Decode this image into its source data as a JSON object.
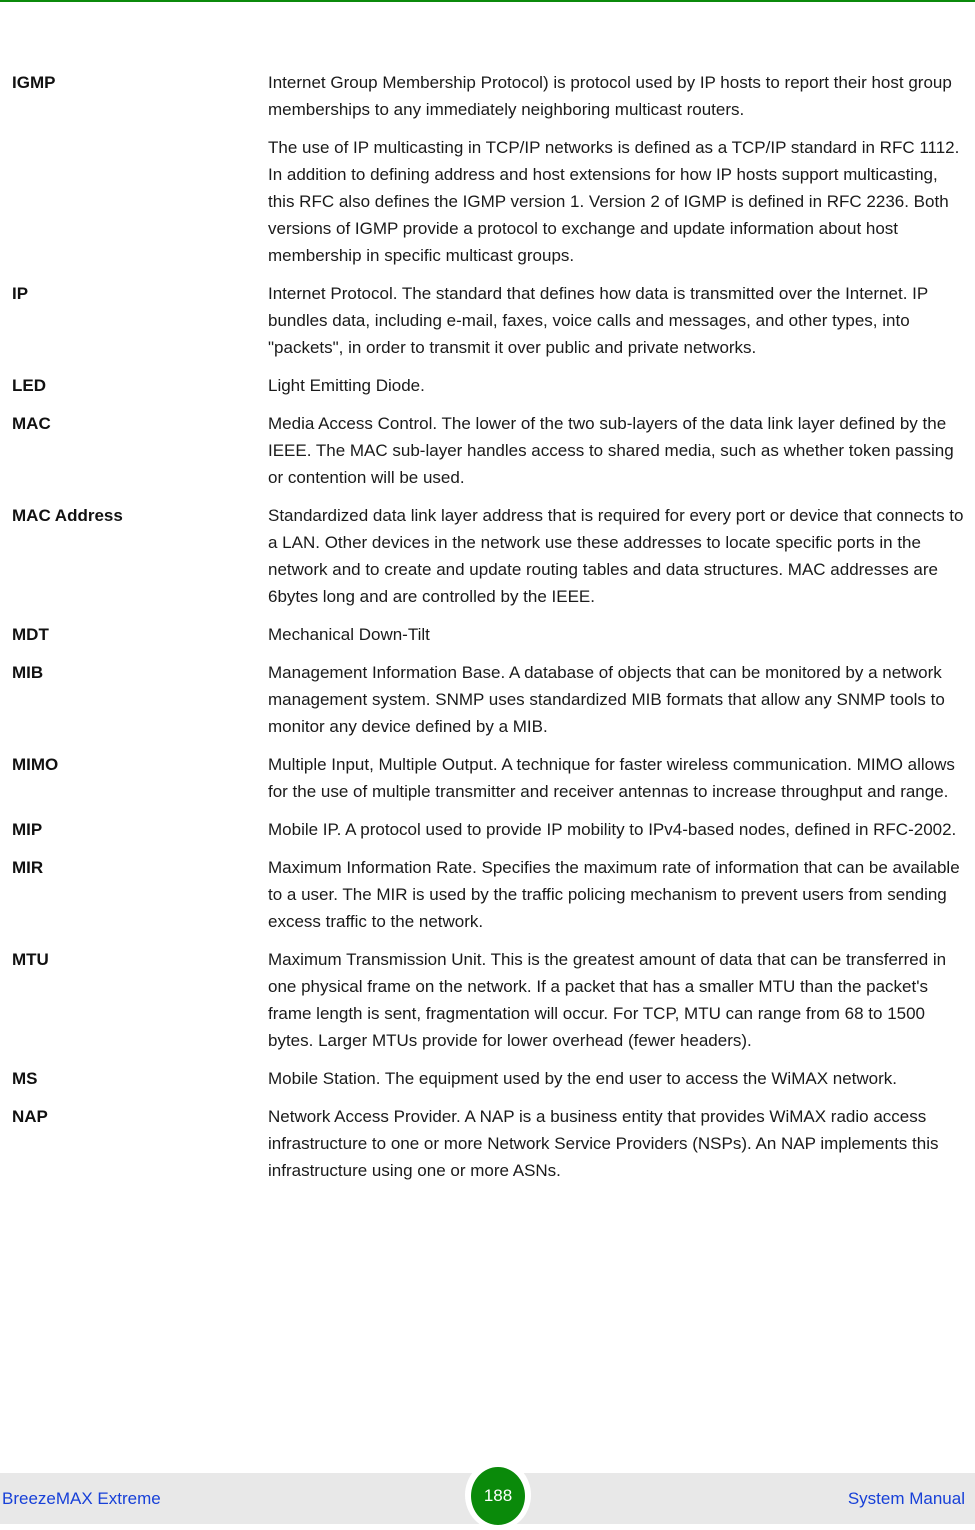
{
  "colors": {
    "accent_green": "#0a8a0a",
    "footer_text_blue": "#1740d8",
    "footer_background": "#e8e8e8"
  },
  "glossary": [
    {
      "term": "IGMP",
      "definitions": [
        "Internet Group Membership Protocol) is protocol used by IP hosts to report their host group memberships to any immediately neighboring multicast routers.",
        "The use of IP multicasting in TCP/IP networks is defined as a TCP/IP standard in RFC 1112. In addition to defining address and host extensions for how IP hosts support multicasting, this RFC also defines the IGMP version 1. Version 2 of IGMP is defined in RFC 2236. Both versions of IGMP provide a protocol to exchange and update information about host membership in specific multicast groups."
      ]
    },
    {
      "term": "IP",
      "definitions": [
        "Internet Protocol. The standard that defines how data is transmitted over the Internet. IP bundles data, including e-mail, faxes, voice calls and messages, and other types, into \"packets\", in order to transmit it over public and private networks."
      ]
    },
    {
      "term": "LED",
      "definitions": [
        "Light Emitting Diode."
      ]
    },
    {
      "term": "MAC",
      "definitions": [
        "Media Access Control. The lower of the two sub-layers of the data link layer defined by the IEEE. The MAC sub-layer handles access to shared media, such as whether token passing or contention will be used."
      ]
    },
    {
      "term": "MAC Address",
      "definitions": [
        "Standardized data link layer address that is required for every port or device that connects to a LAN. Other devices in the network use these addresses to locate specific ports in the network and to create and update routing tables and data structures. MAC addresses are 6bytes long and are controlled by the IEEE."
      ]
    },
    {
      "term": "MDT",
      "definitions": [
        "Mechanical Down-Tilt"
      ]
    },
    {
      "term": "MIB",
      "definitions": [
        "Management Information Base. A database of objects that can be monitored by a network management system. SNMP uses standardized MIB formats that allow any SNMP tools to monitor any device defined by a MIB."
      ]
    },
    {
      "term": "MIMO",
      "definitions": [
        "Multiple Input, Multiple Output. A technique for faster wireless communication. MIMO allows for the use of multiple transmitter and receiver antennas to increase throughput and range."
      ]
    },
    {
      "term": "MIP",
      "definitions": [
        "Mobile IP. A protocol used to provide IP mobility to IPv4-based nodes, defined in RFC-2002."
      ]
    },
    {
      "term": "MIR",
      "definitions": [
        "Maximum Information Rate. Specifies the maximum rate of information that can be available to a user. The MIR is used by the traffic policing mechanism to prevent users from sending excess traffic to the network."
      ]
    },
    {
      "term": "MTU",
      "definitions": [
        "Maximum Transmission Unit. This is the greatest amount of data that can be transferred in one physical frame on the network. If a packet that has a smaller MTU than the packet's frame length is sent, fragmentation will occur. For TCP, MTU can range from 68 to 1500 bytes. Larger MTUs provide for lower overhead (fewer headers)."
      ]
    },
    {
      "term": "MS",
      "definitions": [
        "Mobile Station. The equipment used by the end user to access the WiMAX network."
      ]
    },
    {
      "term": "NAP",
      "definitions": [
        "Network Access Provider. A NAP is a business entity that provides WiMAX radio access infrastructure to one or more Network Service Providers (NSPs). An NAP implements this infrastructure using one or more ASNs."
      ]
    }
  ],
  "footer": {
    "product_name": "BreezeMAX Extreme",
    "page_number": "188",
    "document_type": "System Manual"
  }
}
